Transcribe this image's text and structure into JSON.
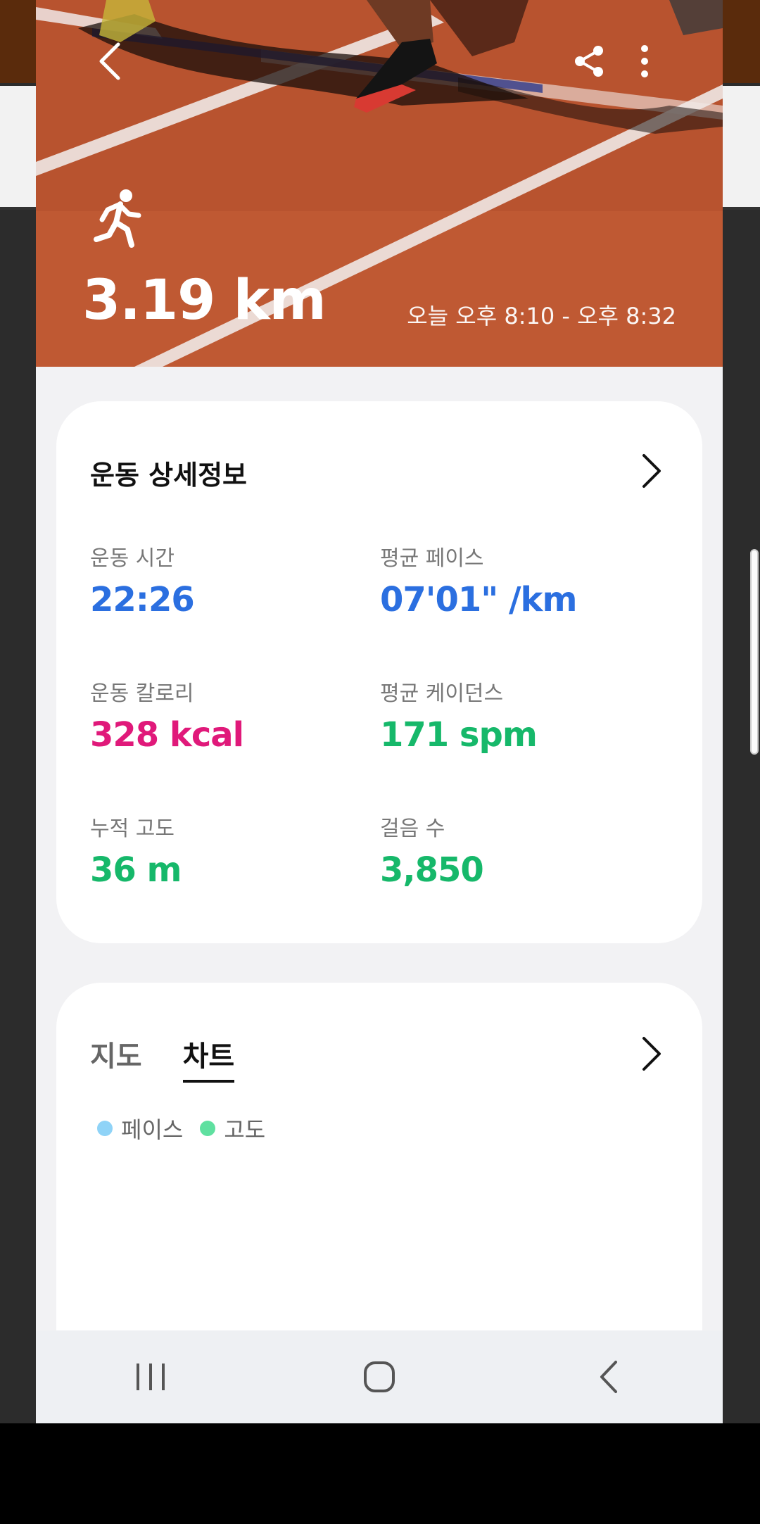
{
  "hero": {
    "distance": "3.19 km",
    "time_range": "오늘 오후 8:10 - 오후 8:32",
    "icons": {
      "back": "chevron-left-icon",
      "share": "share-icon",
      "more": "more-vertical-icon",
      "activity": "running-icon"
    }
  },
  "details": {
    "title": "운동 상세정보",
    "stats": [
      {
        "label": "운동 시간",
        "value": "22:26",
        "color": "#2b6fe0"
      },
      {
        "label": "평균 페이스",
        "value": "07'01\" /km",
        "color": "#2b6fe0"
      },
      {
        "label": "운동 칼로리",
        "value": "328 kcal",
        "color": "#e0197a"
      },
      {
        "label": "평균 케이던스",
        "value": "171 spm",
        "color": "#16b86a"
      },
      {
        "label": "누적 고도",
        "value": "36 m",
        "color": "#16b86a"
      },
      {
        "label": "걸음 수",
        "value": "3,850",
        "color": "#16b86a"
      }
    ]
  },
  "chart_card": {
    "tabs": [
      {
        "label": "지도",
        "active": false
      },
      {
        "label": "차트",
        "active": true
      }
    ],
    "legend": [
      {
        "label": "페이스",
        "color": "#8fd3f7"
      },
      {
        "label": "고도",
        "color": "#5fe0a0"
      }
    ]
  },
  "navbar": {
    "icons": [
      "recent-apps-icon",
      "home-icon",
      "back-icon"
    ]
  }
}
